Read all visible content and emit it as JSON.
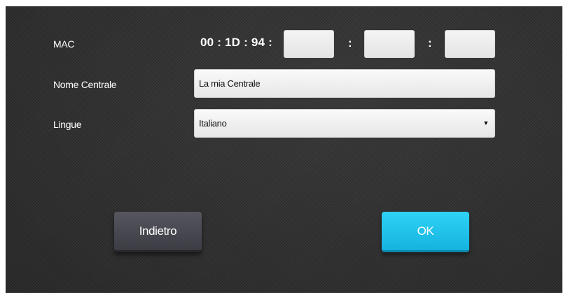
{
  "form": {
    "mac": {
      "label": "MAC",
      "prefix": "00 : 1D : 94 :",
      "separator_1": ":",
      "separator_2": ":",
      "octet_4": "",
      "octet_5": "",
      "octet_6": ""
    },
    "name": {
      "label": "Nome Centrale",
      "value": "La mia Centrale"
    },
    "language": {
      "label": "Lingue",
      "selected": "Italiano",
      "arrow": "▼"
    }
  },
  "buttons": {
    "back_label": "Indietro",
    "ok_label": "OK"
  },
  "colors": {
    "background": "#303030",
    "ok_button": "#1ec3ec",
    "back_button": "#48484f"
  }
}
